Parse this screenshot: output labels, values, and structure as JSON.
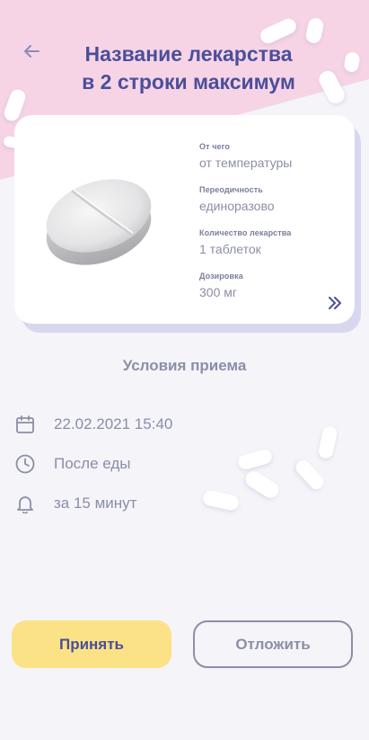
{
  "header": {
    "title_line1": "Название лекарства",
    "title_line2": "в 2 строки максимум",
    "back_icon": "arrow-left-icon"
  },
  "medicine": {
    "reason_label": "От чего",
    "reason_value": "от температуры",
    "frequency_label": "Переодичность",
    "frequency_value": "единоразово",
    "quantity_label": "Количество лекарства",
    "quantity_value": "1 таблеток",
    "dosage_label": "Дозировка",
    "dosage_value": "300 мг",
    "more_icon": "chevrons-right-icon"
  },
  "conditions": {
    "title": "Условия приема",
    "datetime": "22.02.2021 15:40",
    "meal": "После еды",
    "reminder": "за 15 минут"
  },
  "actions": {
    "accept": "Принять",
    "postpone": "Отложить"
  },
  "colors": {
    "primary": "#4b4f9a",
    "accent_yellow": "#fce287",
    "pink_bg": "#f6d4e6",
    "muted_text": "#8b8ea6"
  }
}
